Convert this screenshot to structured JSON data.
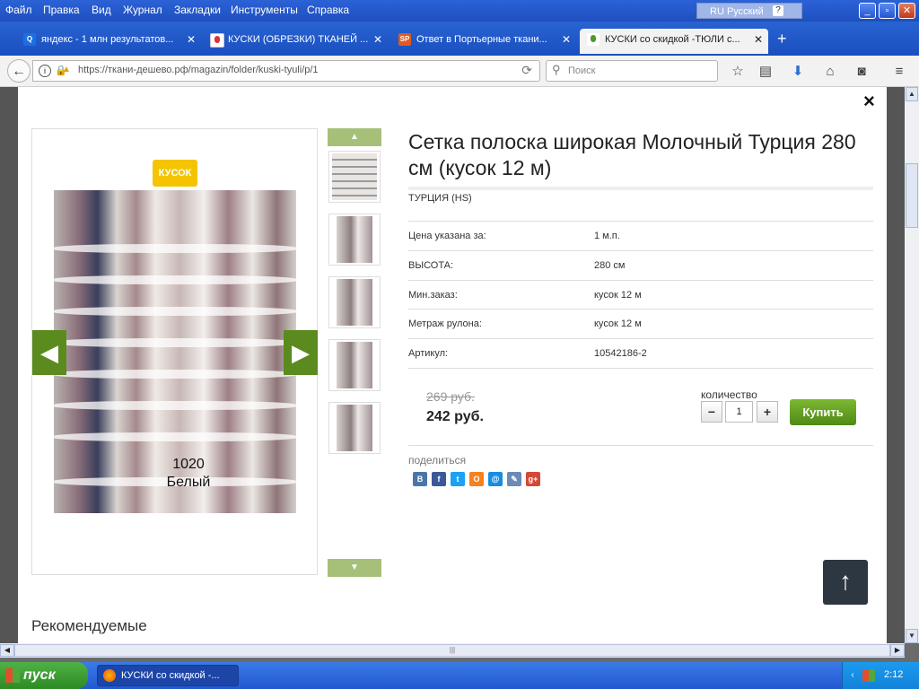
{
  "menu": [
    "Файл",
    "Правка",
    "Вид",
    "Журнал",
    "Закладки",
    "Инструменты",
    "Справка"
  ],
  "language_bar": {
    "label": "RU Русский",
    "help": "?"
  },
  "window_buttons": {
    "minimize": "_",
    "restore": "▫",
    "close": "✕"
  },
  "tabs": [
    {
      "title": "яндекс - 1 млн результатов...",
      "icon": "Q",
      "close": "✕"
    },
    {
      "title": "КУСКИ (ОБРЕЗКИ) ТКАНЕЙ ...",
      "icon": "",
      "close": "✕"
    },
    {
      "title": "Ответ в Портьерные ткани...",
      "icon": "SP",
      "close": "✕"
    },
    {
      "title": "КУСКИ со скидкой -ТЮЛИ с...",
      "icon": "",
      "close": "✕",
      "active": true
    }
  ],
  "new_tab": "+",
  "address": {
    "url": "https://ткани-дешево.рф/magazin/folder/kuski-tyuli/p/1",
    "info": "i"
  },
  "search": {
    "placeholder": "Поиск"
  },
  "modal": {
    "close": "×",
    "badge": "КУСОК",
    "photo_label_line1": "1020",
    "photo_label_line2": "Белый",
    "arrow_prev": "◀",
    "arrow_next": "▶",
    "thumb_up": "▲",
    "thumb_down": "▼",
    "title": "Сетка полоска широкая Молочный Турция 280 см (кусок 12 м)",
    "brand": "ТУРЦИЯ (HS)",
    "specs": [
      {
        "key": "Цена указана за:",
        "value": "1 м.п."
      },
      {
        "key": "ВЫСОТА:",
        "value": "280 см"
      },
      {
        "key": "Мин.заказ:",
        "value": "кусок 12 м"
      },
      {
        "key": "Метраж рулона:",
        "value": "кусок 12 м"
      },
      {
        "key": "Артикул:",
        "value": "10542186-2"
      }
    ],
    "old_price": "269 руб.",
    "price": "242 руб.",
    "qty_label": "количество",
    "qty_value": "1",
    "minus": "−",
    "plus": "+",
    "buy": "Купить",
    "share_label": "поделиться",
    "social": [
      "В",
      "f",
      "t",
      "О",
      "@",
      "✎",
      "g+"
    ],
    "to_top": "↑",
    "recommended": "Рекомендуемые"
  },
  "scroll": {
    "up": "▲",
    "down": "▼",
    "left": "◀",
    "right": "▶",
    "grip": "|||"
  },
  "taskbar": {
    "start": "пуск",
    "item": "КУСКИ со скидкой -...",
    "time": "2:12"
  },
  "colors": {
    "green": "#5b8a1e",
    "badge": "#f4c400",
    "buy": "#6aa427",
    "totop": "#2d3742"
  }
}
